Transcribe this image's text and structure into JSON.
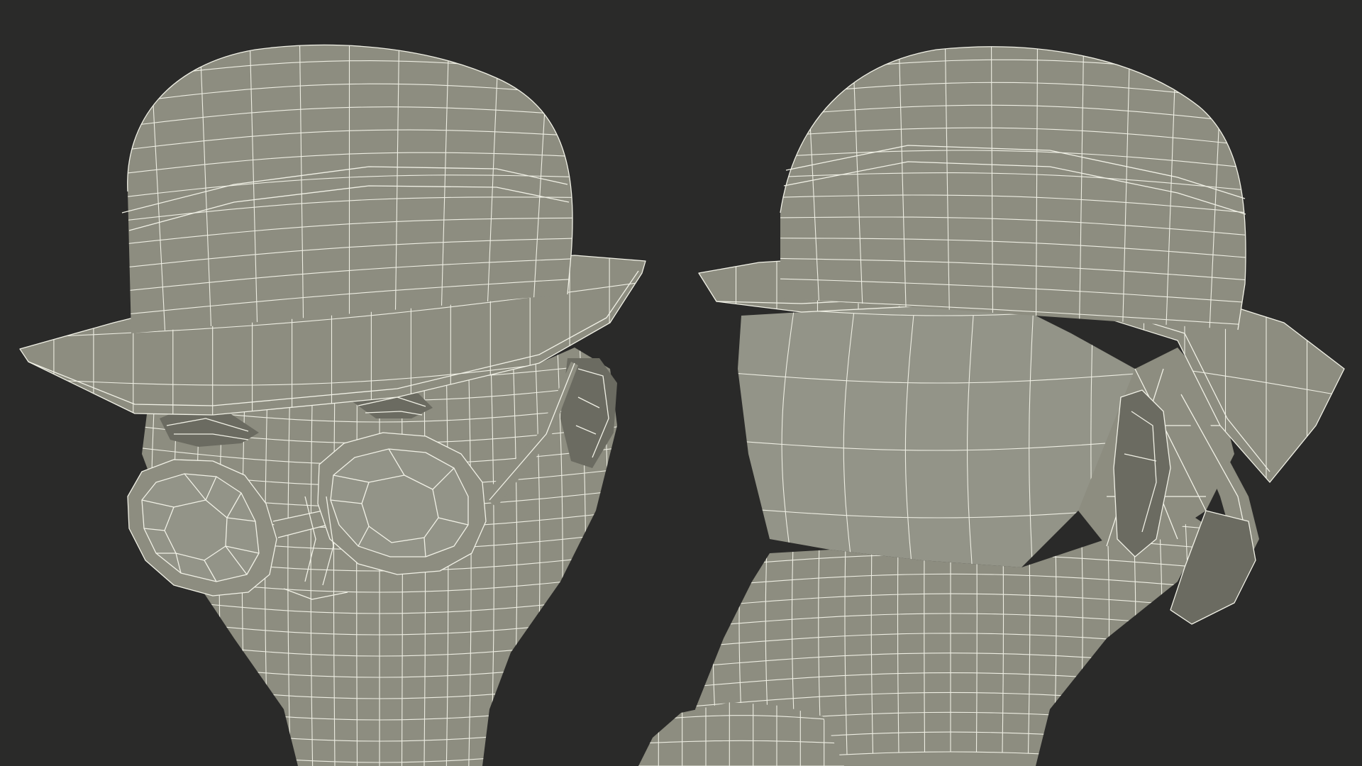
{
  "scene": {
    "background_color": "#2a2a29",
    "mesh_fill_color": "#8d8d80",
    "mesh_shadow_color": "#4d4d47",
    "wire_color": "#f1f1e6",
    "views": [
      {
        "name": "front-three-quarter",
        "subject": "head-with-hat-and-goggles"
      },
      {
        "name": "rear-three-quarter",
        "subject": "head-with-hat-and-goggles"
      }
    ]
  }
}
